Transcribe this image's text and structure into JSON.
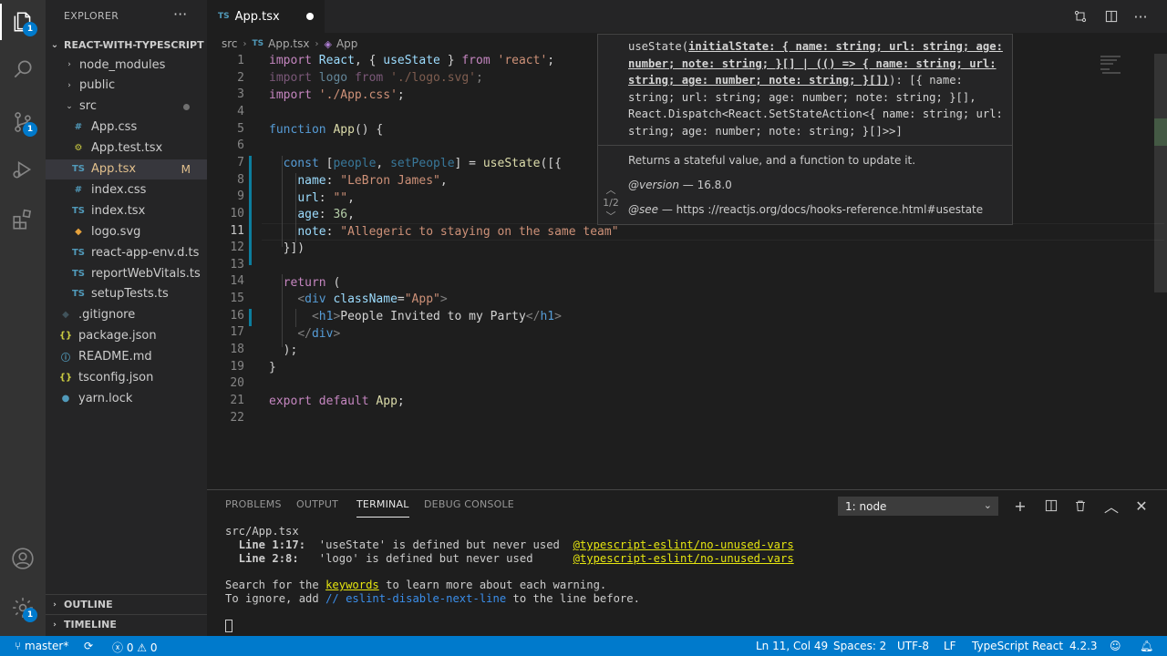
{
  "activity": {
    "explorer_badge": "1",
    "scm_badge": "1",
    "settings_badge": "1"
  },
  "sidebar": {
    "title": "EXPLORER",
    "more": "···",
    "project": "REACT-WITH-TYPESCRIPT",
    "items": [
      {
        "label": "node_modules",
        "icon": "›",
        "kind": "folder"
      },
      {
        "label": "public",
        "icon": "›",
        "kind": "folder"
      },
      {
        "label": "src",
        "icon": "⌄",
        "kind": "folder-open"
      },
      {
        "label": "App.css",
        "icon": "#",
        "kind": "css"
      },
      {
        "label": "App.test.tsx",
        "icon": "⚙",
        "kind": "test"
      },
      {
        "label": "App.tsx",
        "icon": "TS",
        "kind": "ts",
        "status": "M"
      },
      {
        "label": "index.css",
        "icon": "#",
        "kind": "css"
      },
      {
        "label": "index.tsx",
        "icon": "TS",
        "kind": "ts"
      },
      {
        "label": "logo.svg",
        "icon": "◆",
        "kind": "svg"
      },
      {
        "label": "react-app-env.d.ts",
        "icon": "TS",
        "kind": "ts"
      },
      {
        "label": "reportWebVitals.ts",
        "icon": "TS",
        "kind": "ts"
      },
      {
        "label": "setupTests.ts",
        "icon": "TS",
        "kind": "ts"
      },
      {
        "label": ".gitignore",
        "icon": "◆",
        "kind": "git"
      },
      {
        "label": "package.json",
        "icon": "{}",
        "kind": "json"
      },
      {
        "label": "README.md",
        "icon": "ⓘ",
        "kind": "md"
      },
      {
        "label": "tsconfig.json",
        "icon": "{}",
        "kind": "json"
      },
      {
        "label": "yarn.lock",
        "icon": "●",
        "kind": "lock"
      }
    ],
    "outline": "OUTLINE",
    "timeline": "TIMELINE"
  },
  "tab": {
    "prefix": "TS",
    "label": "App.tsx"
  },
  "breadcrumb": {
    "folder": "src",
    "prefix": "TS",
    "file": "App.tsx",
    "symbol": "App"
  },
  "editor": {
    "line_numbers": [
      "1",
      "2",
      "3",
      "4",
      "5",
      "6",
      "7",
      "8",
      "9",
      "10",
      "11",
      "12",
      "13",
      "14",
      "15",
      "16",
      "17",
      "18",
      "19",
      "20",
      "21",
      "22"
    ],
    "l1": {
      "a": "import",
      "b": "React",
      "c": ", { ",
      "d": "useState",
      "e": " } ",
      "f": "from",
      "g": "'react'",
      "h": ";"
    },
    "l2": {
      "a": "import",
      "b": "logo",
      "c": "from",
      "d": "'./logo.svg'",
      "e": ";"
    },
    "l3": {
      "a": "import",
      "b": "'./App.css'",
      "c": ";"
    },
    "l5": {
      "a": "function",
      "b": "App",
      "c": "() {"
    },
    "l7": {
      "a": "const",
      "b": "[",
      "c": "people",
      "d": ", ",
      "e": "setPeople",
      "f": "] = ",
      "g": "useState",
      "h": "([{"
    },
    "l8": {
      "a": "name",
      "b": ": ",
      "c": "\"LeBron James\"",
      "d": ","
    },
    "l9": {
      "a": "url",
      "b": ": ",
      "c": "\"\"",
      "d": ","
    },
    "l10": {
      "a": "age",
      "b": ": ",
      "c": "36",
      "d": ","
    },
    "l11": {
      "a": "note",
      "b": ": ",
      "c": "\"Allegeric to staying on the same team\""
    },
    "l12": {
      "a": "}])"
    },
    "l14": {
      "a": "return",
      "b": " ("
    },
    "l15": {
      "a": "<",
      "b": "div",
      "c": "className",
      "d": "=",
      "e": "\"App\"",
      "f": ">"
    },
    "l16": {
      "a": "<",
      "b": "h1",
      "c": ">",
      "d": "People Invited to my Party",
      "e": "</",
      "f": "h1",
      "g": ">"
    },
    "l17": {
      "a": "</",
      "b": "div",
      "c": ">"
    },
    "l18": {
      "a": ");"
    },
    "l19": {
      "a": "}"
    },
    "l21": {
      "a": "export",
      "b": "default",
      "c": "App",
      "d": ";"
    }
  },
  "hover": {
    "sig_fn": "useState(",
    "sig_param": "initialState: { name: string; url: string; age: number; note: string; }[] | (() => { name: string; url: string; age: number; note: string; }[])",
    "sig_rest": "): [{ name: string; url: string; age: number; note: string; }[], React.Dispatch<React.SetStateAction<{ name: string; url: string; age: number; note: string; }[]>>]",
    "description": "Returns a stateful value, and a function to update it.",
    "version_tag": "@version",
    "version_value": "— 16.8.0",
    "see_tag": "@see",
    "see_value": "— https ://reactjs.org/docs/hooks-reference.html#usestate",
    "nav_count": "1/2"
  },
  "panel": {
    "tabs": [
      "PROBLEMS",
      "OUTPUT",
      "TERMINAL",
      "DEBUG CONSOLE"
    ],
    "active_tab": "TERMINAL",
    "terminal_select": "1: node",
    "terminal": {
      "file": "src/App.tsx",
      "w1_loc": "  Line 1:17:",
      "w1_msg": "  'useState' is defined but never used  ",
      "w1_rule": "@typescript-eslint/no-unused-vars",
      "w2_loc": "  Line 2:8:",
      "w2_msg": "   'logo' is defined but never used      ",
      "w2_rule": "@typescript-eslint/no-unused-vars",
      "s1_a": "Search for the ",
      "s1_b": "keywords",
      "s1_c": " to learn more about each warning.",
      "s2_a": "To ignore, add ",
      "s2_b": "// eslint-disable-next-line",
      "s2_c": " to the line before."
    }
  },
  "status": {
    "branch": "master*",
    "sync": "⟳",
    "errors": "0",
    "warnings": "0",
    "position": "Ln 11, Col 49",
    "spaces": "Spaces: 2",
    "encoding": "UTF-8",
    "eol": "LF",
    "language": "TypeScript React",
    "ts_version": "4.2.3",
    "colors": {
      "bar": "#007acc"
    }
  }
}
